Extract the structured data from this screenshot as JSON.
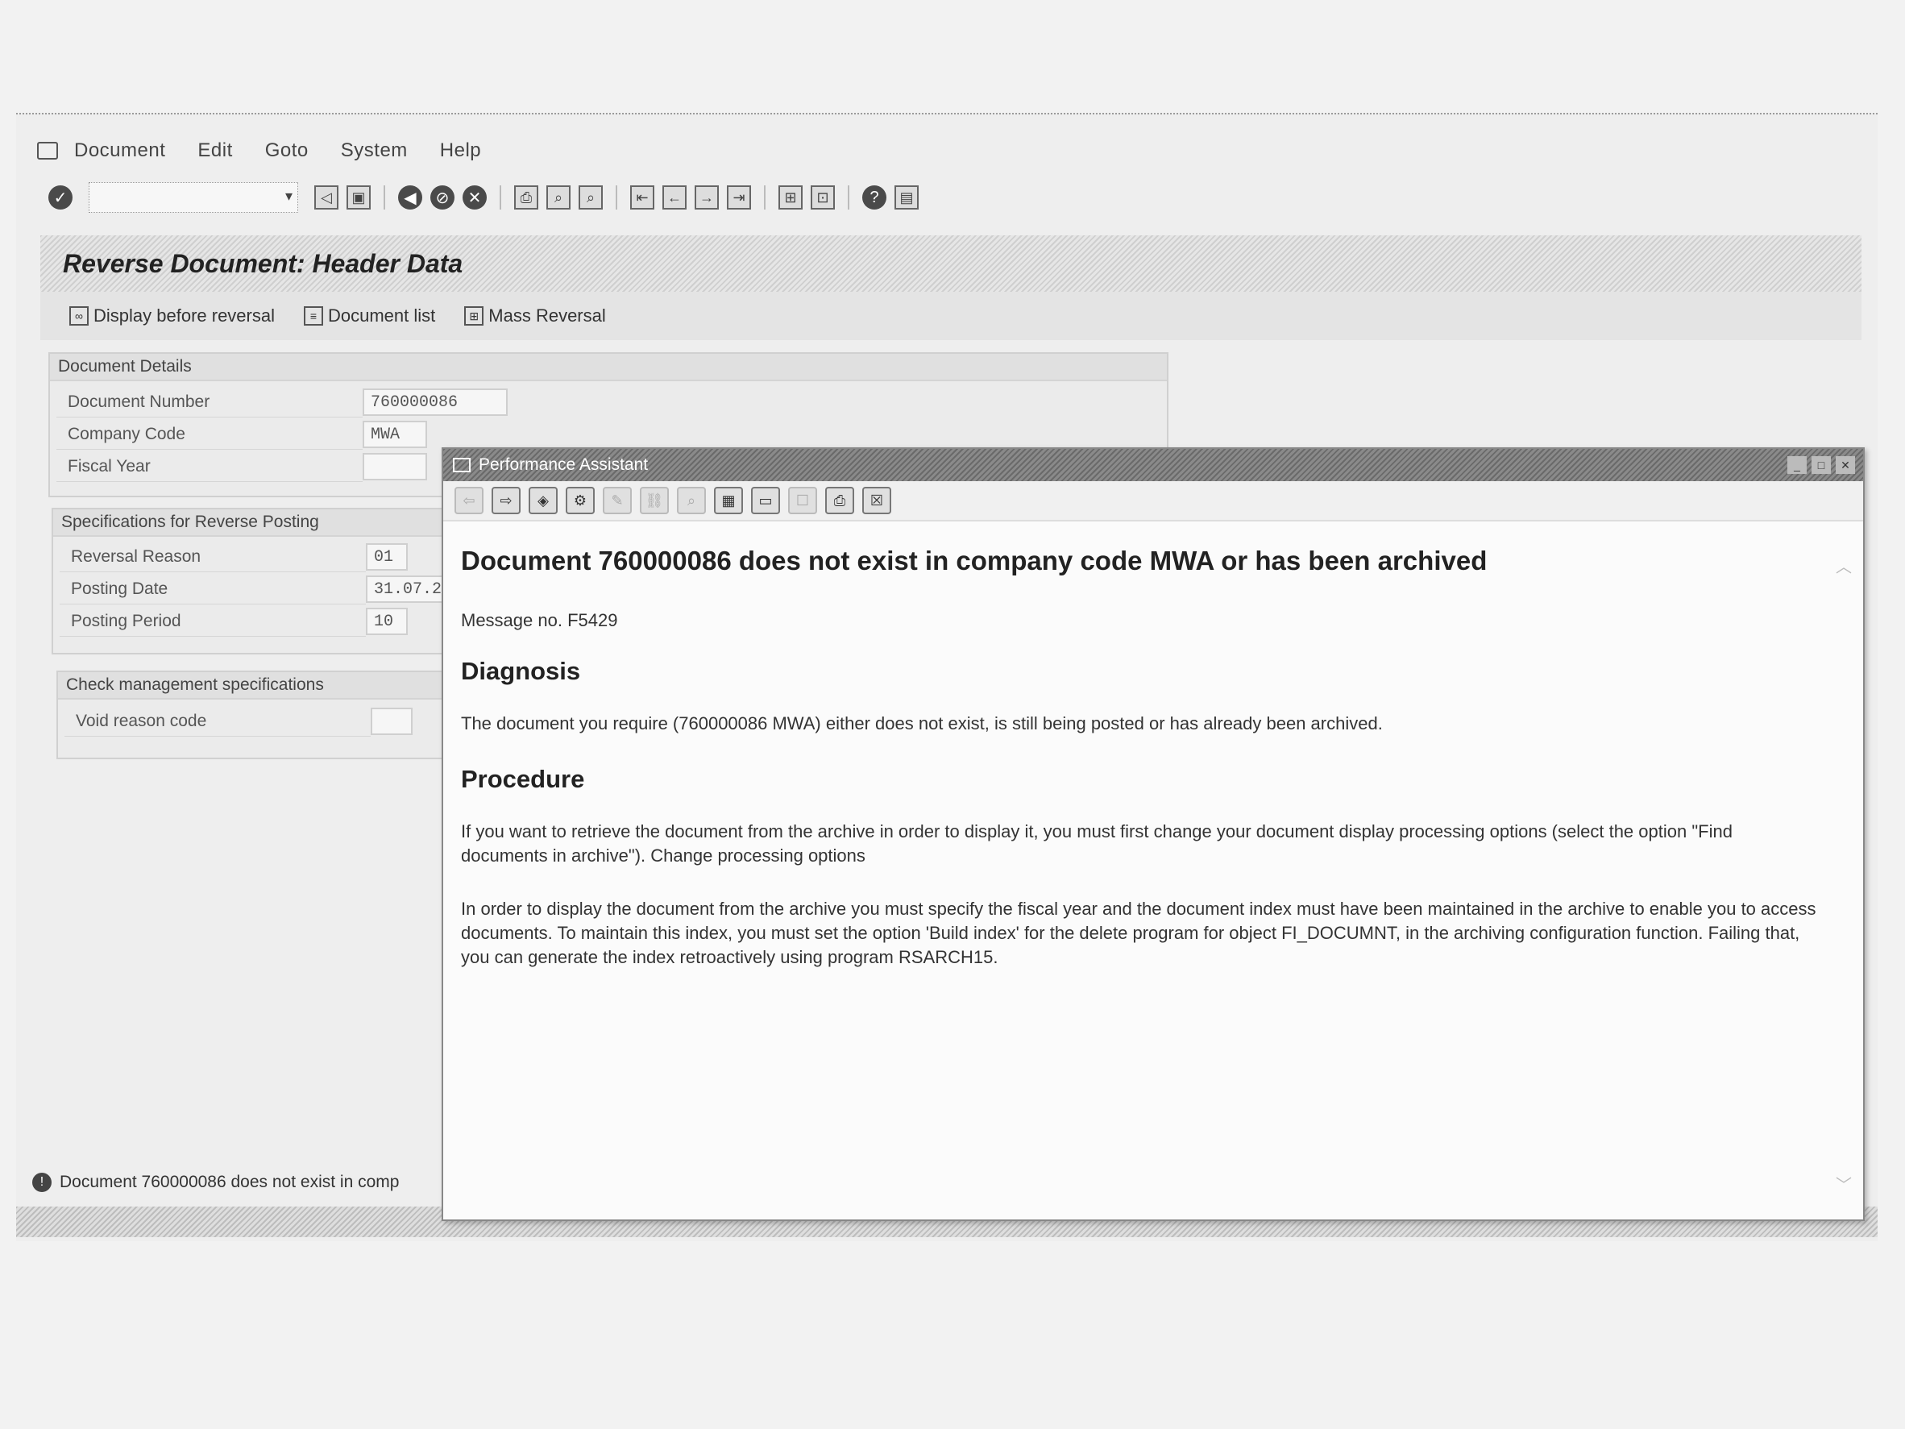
{
  "menu": {
    "items": [
      "Document",
      "Edit",
      "Goto",
      "System",
      "Help"
    ]
  },
  "toolbar": {
    "command_field_value": ""
  },
  "screen": {
    "title": "Reverse Document: Header Data",
    "app_buttons": [
      "Display before reversal",
      "Document list",
      "Mass Reversal"
    ]
  },
  "document_details": {
    "title": "Document Details",
    "document_number_label": "Document Number",
    "document_number": "760000086",
    "company_code_label": "Company Code",
    "company_code": "MWA",
    "fiscal_year_label": "Fiscal Year",
    "fiscal_year": ""
  },
  "reverse_posting": {
    "title": "Specifications for Reverse Posting",
    "reversal_reason_label": "Reversal Reason",
    "reversal_reason": "01",
    "posting_date_label": "Posting Date",
    "posting_date": "31.07.20",
    "posting_period_label": "Posting Period",
    "posting_period": "10"
  },
  "check_management": {
    "title": "Check management specifications",
    "void_reason_label": "Void reason code",
    "void_reason": ""
  },
  "status": {
    "message": "Document 760000086 does not exist in comp"
  },
  "dialog": {
    "title": "Performance Assistant",
    "heading": "Document 760000086 does not exist in company code MWA or has been archived",
    "message_no": "Message no. F5429",
    "diagnosis_heading": "Diagnosis",
    "diagnosis_text": "The document you require (760000086 MWA) either does not exist, is still being posted or has already been archived.",
    "procedure_heading": "Procedure",
    "procedure_text_1": "If you want to retrieve the document from the archive in order to display it, you must first change your document display processing options (select the option \"Find documents in archive\").",
    "procedure_link": "Change processing options",
    "procedure_text_2": "In order to display the document from the archive you must specify the fiscal year and the document index must have been maintained in the archive to enable you to access documents. To maintain this index, you must set the option 'Build index' for the delete program for object FI_DOCUMNT, in the archiving configuration function. Failing that, you can generate the index retroactively using program RSARCH15."
  }
}
